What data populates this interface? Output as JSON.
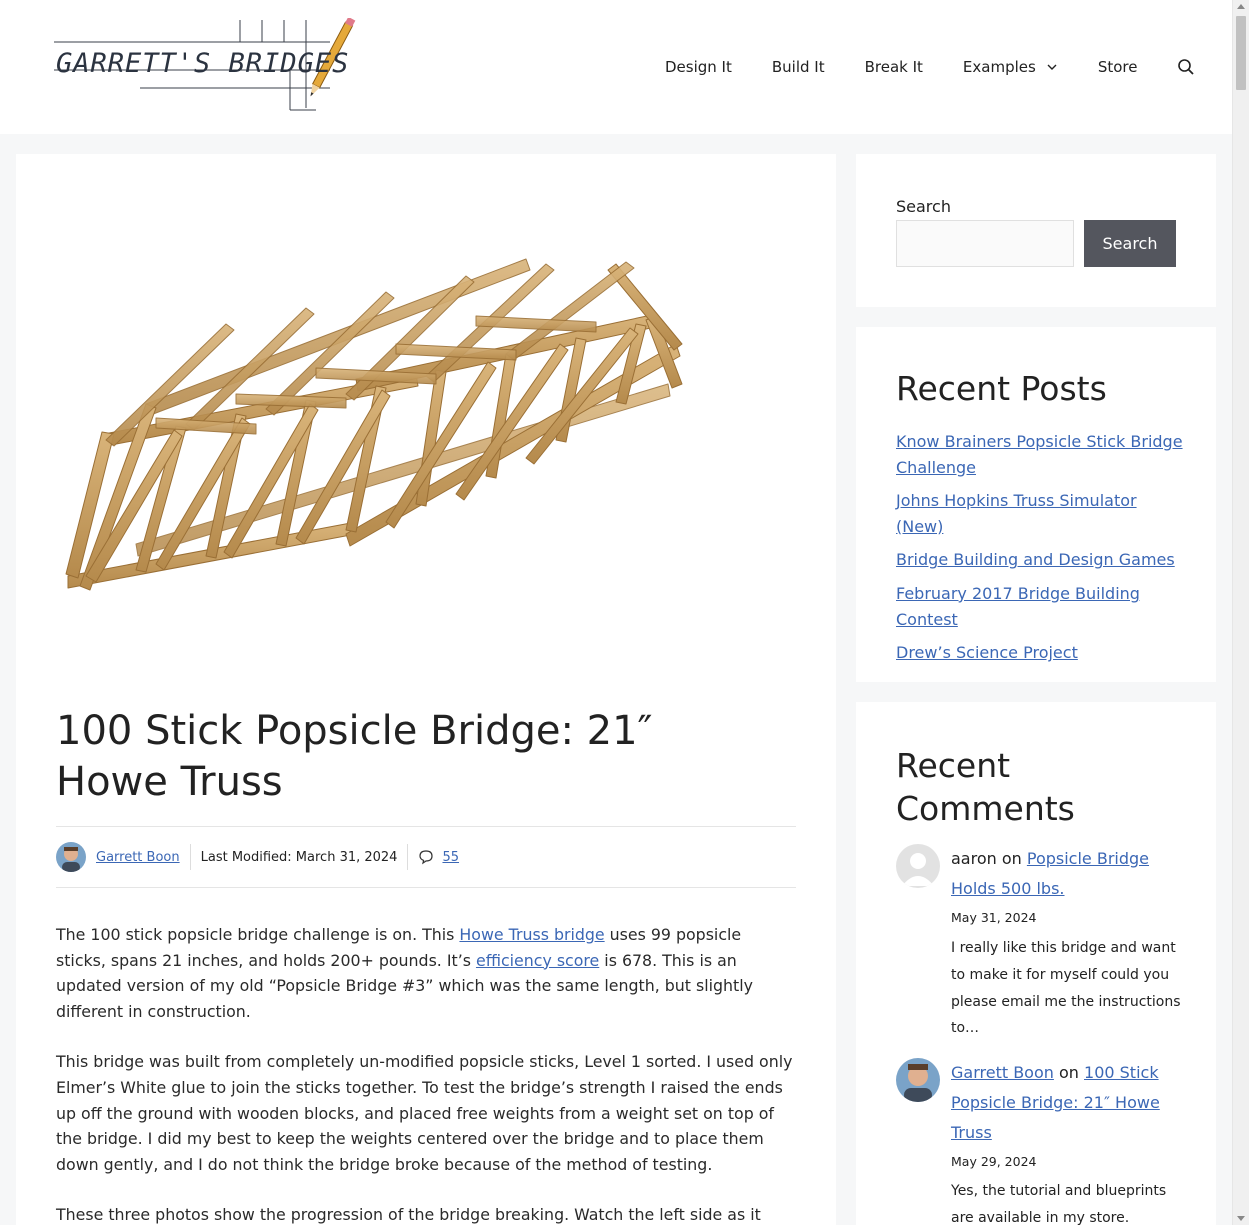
{
  "header": {
    "logo_text": "GARRETT'S BRIDGES",
    "nav": [
      "Design It",
      "Build It",
      "Break It",
      "Examples",
      "Store"
    ]
  },
  "post": {
    "title": "100 Stick Popsicle Bridge: 21″ Howe Truss",
    "author": "Garrett Boon",
    "last_modified": "Last Modified: March 31, 2024",
    "comment_count": "55",
    "p1_a": "The 100 stick popsicle bridge challenge is on. This ",
    "p1_link1": "Howe Truss bridge",
    "p1_b": " uses 99 popsicle sticks, spans 21 inches, and holds 200+ pounds. It’s ",
    "p1_link2": "efficiency score",
    "p1_c": " is 678. This is an updated version of my old “Popsicle Bridge #3” which was the same length, but slightly different in construction.",
    "p2": "This bridge was built from completely un-modified popsicle sticks, Level 1 sorted. I used only Elmer’s White glue to join the sticks together. To test the bridge’s strength I raised the ends up off the ground with wooden blocks, and placed free weights from a weight set on top of the bridge. I did my best to keep the weights centered over the bridge and to place them down gently, and I do not think the bridge broke because of the method of testing.",
    "p3": "These three photos show the progression of the bridge breaking. Watch the left side as it starts to fail."
  },
  "sidebar": {
    "search_label": "Search",
    "search_button": "Search",
    "recent_posts_title": "Recent Posts",
    "recent_posts": [
      "Know Brainers Popsicle Stick Bridge Challenge",
      "Johns Hopkins Truss Simulator (New)",
      "Bridge Building and Design Games",
      "February 2017 Bridge Building Contest",
      "Drew’s Science Project"
    ],
    "recent_comments_title": "Recent Comments",
    "comments": [
      {
        "author": "aaron",
        "on": " on ",
        "post": "Popsicle Bridge Holds 500 lbs.",
        "date": "May 31, 2024",
        "excerpt": "I really like this bridge and want to make it for myself could you please email me the instructions to…"
      },
      {
        "author": "Garrett Boon",
        "on": " on ",
        "post": "100 Stick Popsicle Bridge: 21″ Howe Truss",
        "date": "May 29, 2024",
        "excerpt": "Yes, the tutorial and blueprints are available in my store."
      }
    ]
  },
  "colors": {
    "link": "#3b67b5",
    "button": "#54565e",
    "wood": "#c9a36a"
  }
}
